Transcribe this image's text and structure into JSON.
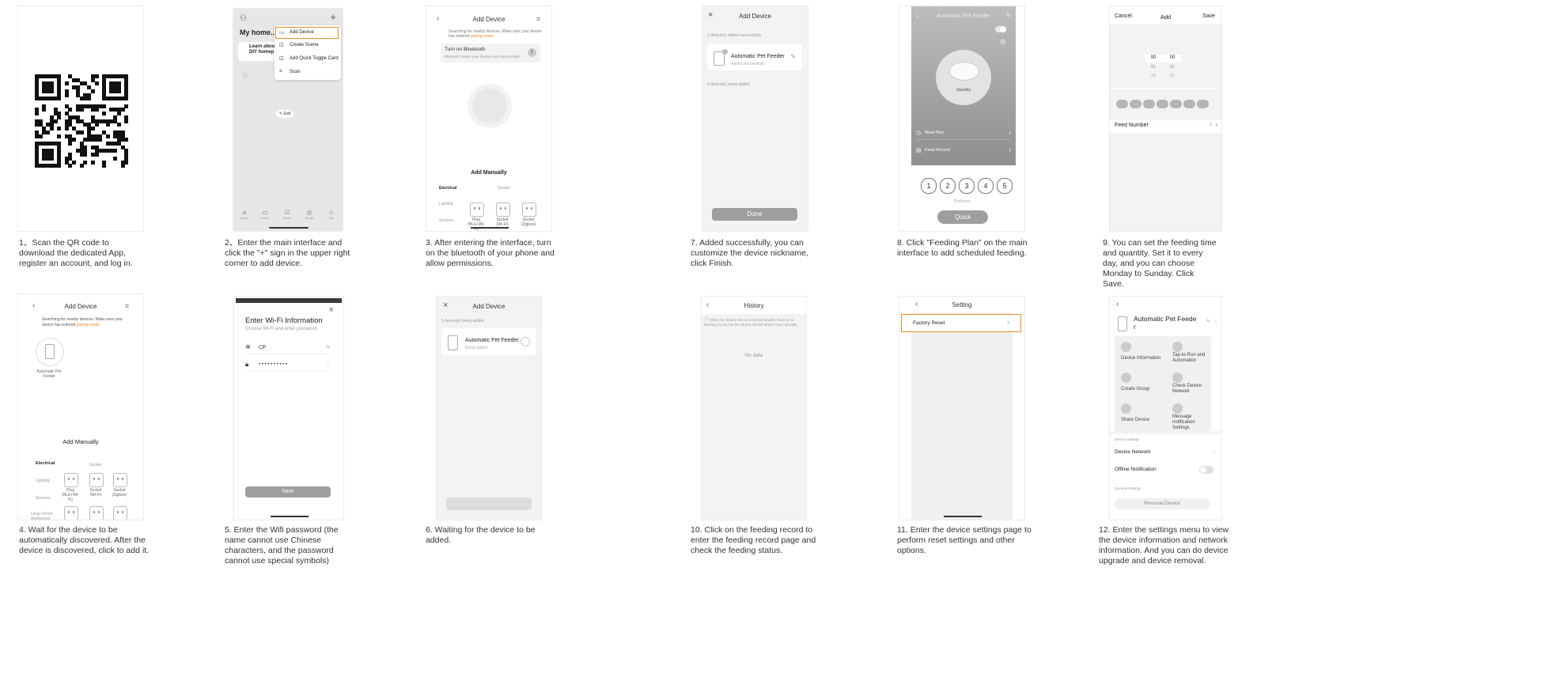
{
  "steps": {
    "s1": {
      "caption": "1、Scan the QR code to download the dedicated App, register an account, and log in."
    },
    "s2": {
      "caption": "2、Enter the main interface and click the \"+\" sign in the upper right corner to add device.",
      "home_title": "My home..",
      "learn_line1": "Learn abou",
      "learn_line2": "DIY homep",
      "menu": [
        "Add Device",
        "Create Scene",
        "Add Quick Toggle Card",
        "Scan"
      ],
      "edit_label": "Edit",
      "nav": [
        "Home",
        "Scene",
        "Smart",
        "Smart",
        "Me"
      ]
    },
    "s3": {
      "caption": "3. After entering the interface, turn on the bluetooth of your phone and allow permissions.",
      "title": "Add Device",
      "searching": "Searching for nearby devices. Make sure your device has entered",
      "pairing_mode": "pairing mode",
      "bt_title": "Turn on Bluetooth",
      "bt_sub": "Bluetooth makes your device more discoverable.",
      "add_manually": "Add Manually",
      "categories": [
        "Electrical",
        "Lighting",
        "Sensors"
      ],
      "socket_header": "Socket",
      "sockets": [
        "Plug (BLE+Wi-Fi)",
        "Socket (Wi-Fi)",
        "Socket (Zigbee)"
      ]
    },
    "s4": {
      "caption": "4. Wait for the device to be automatically discovered. After the device is discovered, click to add it.",
      "title": "Add Device",
      "searching": "Searching for nearby devices. Make sure your device has entered",
      "pairing_mode": "pairing mode.",
      "device_name": "Automatic Pet Feeder",
      "add_manually": "Add Manually",
      "categories": [
        "Electrical",
        "Lighting",
        "Sensors",
        "Large Home Appliances"
      ],
      "socket_header": "Socket",
      "sockets": [
        "Plug (BLE+Wi-Fi)",
        "Socket (Wi-Fi)",
        "Socket (Zigbee)"
      ]
    },
    "s5": {
      "caption": "5. Enter the Wifi password (the name cannot use Chinese characters, and the password cannot use special symbols)",
      "title": "Enter Wi-Fi Information",
      "subtitle": "Choose Wi-Fi and enter password",
      "ssid": "CP",
      "password_mask": "• • • • • • • • • •",
      "next_label": "Next"
    },
    "s6": {
      "caption": "6. Waiting for the device to be added.",
      "title": "Add Device",
      "status": "1 device(s) being added",
      "device_name": "Automatic Pet Feeder",
      "device_status": "Being added"
    },
    "s7": {
      "caption": "7. Added successfully, you can customize the device nickname, click Finish.",
      "title": "Add Device",
      "status": "1 device(s) added successfully",
      "device_name": "Automatic Pet Feeder",
      "device_status": "Added successfully",
      "pending": "0 device(s) being added",
      "done_label": "Done"
    },
    "s8": {
      "caption": "8. Click \"Feeding Plan\" on the main interface to add scheduled feeding.",
      "title": "Automatic Pet Feeder",
      "standby": "Standby",
      "meal_plan": "Meal Plan",
      "feed_record": "Feed Record",
      "portions": [
        "1",
        "2",
        "3",
        "4",
        "5"
      ],
      "portions_label": "Portions",
      "quick_label": "Quick"
    },
    "s9": {
      "caption": "9. You can set the feeding time and quantity. Set it to every day, and you can choose Monday to Sunday. Click Save.",
      "cancel": "Cancel",
      "title": "Add",
      "save": "Save",
      "hours": [
        "00",
        "01",
        "02"
      ],
      "minutes": [
        "00",
        "01",
        "02"
      ],
      "feed_number_label": "Feed Number",
      "feed_number_value": "1"
    },
    "s10": {
      "caption": "10. Click on the feeding record to enter the feeding record page and check the feeding status.",
      "title": "History",
      "note": "When the device has no external network, there is no feeding record, but the device will still deliver food normally.",
      "empty": "No data"
    },
    "s11": {
      "caption": "11. Enter the device settings page to perform reset settings and other options.",
      "title": "Setting",
      "factory_reset": "Factory Reset"
    },
    "s12": {
      "caption": "12. Enter the settings menu to view the device information and network information. And you can do device upgrade and device removal.",
      "device_name_1": "Automatic Pet Feede",
      "device_name_2": "r",
      "tiles": [
        "Device Information",
        "Tap-to-Run and Automation",
        "Create Group",
        "Check Device Network",
        "Share Device",
        "Message notification Settings"
      ],
      "device_settings_header": "Device Settings",
      "device_network": "Device Network",
      "offline_notification": "Offline Notification",
      "general_settings_header": "General Settings",
      "remove_device": "Remove Device"
    }
  },
  "colors": {
    "accent": "#f08a24",
    "panel_bg": "#f3f3f3",
    "grey_button": "#9e9e9e"
  },
  "icons": [
    "qr-code",
    "user-icon",
    "plus-icon",
    "back-icon",
    "scan-icon",
    "close-icon",
    "bluetooth-icon",
    "wifi-icon",
    "lock-icon",
    "edit-icon",
    "chevron-right-icon",
    "clock-icon",
    "list-icon",
    "gear-icon"
  ]
}
